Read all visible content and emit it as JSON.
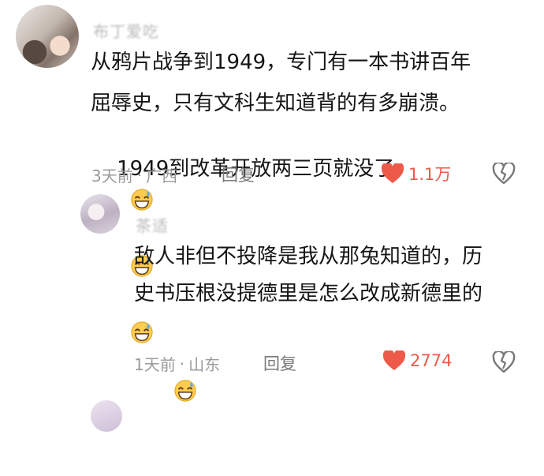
{
  "comments": [
    {
      "username": "布丁爱吃",
      "text_line1": "从鸦片战争到1949，专门有一本书讲百年",
      "text_line2": "屈辱史，只有文科生知道背的有多崩溃。",
      "text_line3": "1949到改革开放两三页就没了",
      "emoji_icon": "grinning-sweat-emoji",
      "time": "3天前",
      "separator": "·",
      "location": "广西",
      "reply_label": "回复",
      "like_count": "1.1万",
      "like_color": "#ee5a4a"
    },
    {
      "username": "茶适",
      "text_line1": "敌人非但不投降是我从那兔知道的，历",
      "text_line2": "史书压根没提德里是怎么改成新德里的",
      "emoji_icon": "grinning-sweat-emoji",
      "time": "1天前",
      "separator": "·",
      "location": "山东",
      "reply_label": "回复",
      "like_count": "2774",
      "like_color": "#ee5a4a"
    }
  ]
}
